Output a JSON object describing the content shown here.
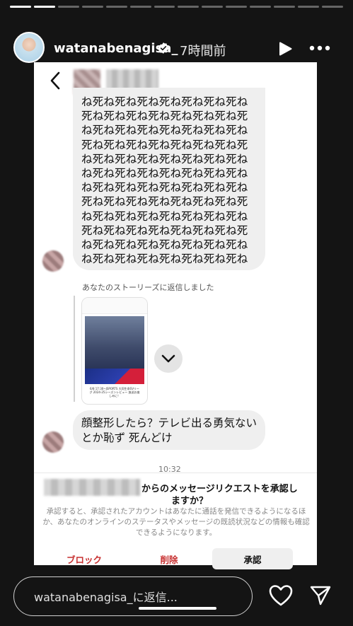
{
  "story": {
    "progress": {
      "segments_total": 14,
      "segments_complete": 2
    },
    "username": "watanabenagisa_",
    "time_ago": "7時間前"
  },
  "dm": {
    "spam_lines": [
      "ね死ね死ね死ね死ね死ね死ね死ね",
      "死ね死ね死ね死ね死ね死ね死ね死",
      "ね死ね死ね死ね死ね死ね死ね死ね",
      "死ね死ね死ね死ね死ね死ね死ね死",
      "ね死ね死ね死ね死ね死ね死ね死ね",
      "ね死ね死ね死ね死ね死ね死ね死ね",
      "ね死ね死ね死ね死ね死ね死ね死ね",
      "死ね死ね死ね死ね死ね死ね死ね死",
      "ね死ね死ね死ね死ね死ね死ね死ね",
      "死ね死ね死ね死ね死ね死ね死ね死",
      "ね死ね死ね死ね死ね死ね死ね死ね",
      "ね死ね死ね死ね死ね死ね死ね死ね"
    ],
    "reply_note": "あなたのストーリーズに返信しました",
    "story_thumb_text": "6/8 17:30~JSPORTS 大同生命SVリーグ 2024-25シーズンレビュー 放送お楽しみに！",
    "message": "顔整形したら？テレビ出る勇気ないとか恥ず 死んどけ",
    "timestamp": "10:32"
  },
  "request": {
    "title_line1": "からのメッセージリクエストを承認し",
    "title_line2": "ますか？",
    "description": "承認すると、承認されたアカウントはあなたに通話を発信できるようになるほか、あなたのオンラインのステータスやメッセージの既読状況などの情報も確認できるようになります。",
    "block_label": "ブロック",
    "delete_label": "削除",
    "accept_label": "承認",
    "danger_color": "#c72f2f"
  },
  "reply_bar": {
    "placeholder": "watanabenagisa_に返信..."
  },
  "icons": [
    "verified-badge-icon",
    "play-icon",
    "more-icon",
    "back-chevron-icon",
    "chevron-down-icon",
    "heart-icon",
    "send-icon"
  ]
}
